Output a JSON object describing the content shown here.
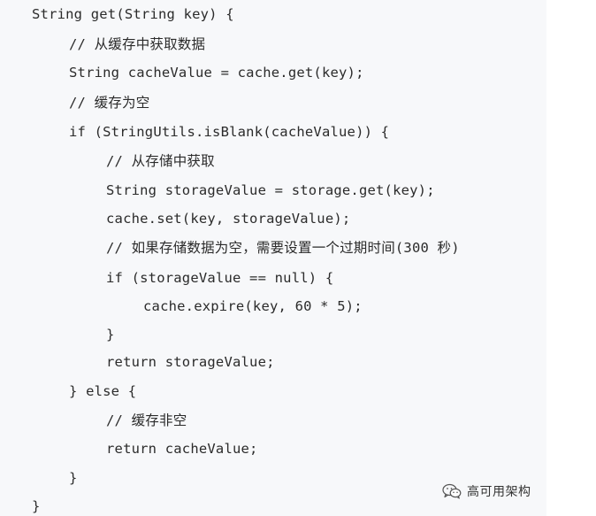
{
  "code": {
    "lines": [
      "String get(String key) {",
      "// 从缓存中获取数据",
      "String cacheValue = cache.get(key);",
      "// 缓存为空",
      "if (StringUtils.isBlank(cacheValue)) {",
      "// 从存储中获取",
      "String storageValue = storage.get(key);",
      "cache.set(key, storageValue);",
      "// 如果存储数据为空，需要设置一个过期时间(300 秒)",
      "if (storageValue == null) {",
      "cache.expire(key, 60 * 5);",
      "}",
      "return storageValue;",
      "} else {",
      "// 缓存非空",
      "return cacheValue;",
      "}",
      "}"
    ]
  },
  "watermark": {
    "text": "高可用架构",
    "icon": "wechat-icon"
  }
}
